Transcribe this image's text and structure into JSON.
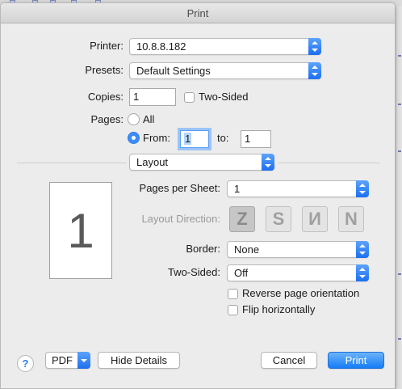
{
  "window": {
    "title": "Print"
  },
  "printer": {
    "label": "Printer:",
    "value": "10.8.8.182"
  },
  "presets": {
    "label": "Presets:",
    "value": "Default Settings"
  },
  "copies": {
    "label": "Copies:",
    "value": "1",
    "two_sided_label": "Two-Sided",
    "two_sided_checked": false
  },
  "pages": {
    "label": "Pages:",
    "all_label": "All",
    "from_label": "From:",
    "from_value": "1",
    "to_label": "to:",
    "to_value": "1",
    "selected": "from"
  },
  "section_popup": {
    "value": "Layout"
  },
  "preview": {
    "page_number": "1"
  },
  "layout": {
    "pages_per_sheet": {
      "label": "Pages per Sheet:",
      "value": "1"
    },
    "layout_direction": {
      "label": "Layout Direction:",
      "buttons": [
        {
          "glyph": "Z",
          "icon": "z-direction-icon",
          "selected": true
        },
        {
          "glyph": "S",
          "icon": "s-direction-icon",
          "selected": false
        },
        {
          "glyph": "И",
          "icon": "reverse-n-direction-icon",
          "selected": false
        },
        {
          "glyph": "N",
          "icon": "n-direction-icon",
          "selected": false
        }
      ]
    },
    "border": {
      "label": "Border:",
      "value": "None"
    },
    "two_sided": {
      "label": "Two-Sided:",
      "value": "Off"
    },
    "reverse_orientation_label": "Reverse page orientation",
    "flip_horizontally_label": "Flip horizontally"
  },
  "footer": {
    "help_glyph": "?",
    "pdf_label": "PDF",
    "hide_details_label": "Hide Details",
    "cancel_label": "Cancel",
    "print_label": "Print"
  },
  "colors": {
    "accent": "#1d7cf6",
    "background": "#ececec"
  }
}
